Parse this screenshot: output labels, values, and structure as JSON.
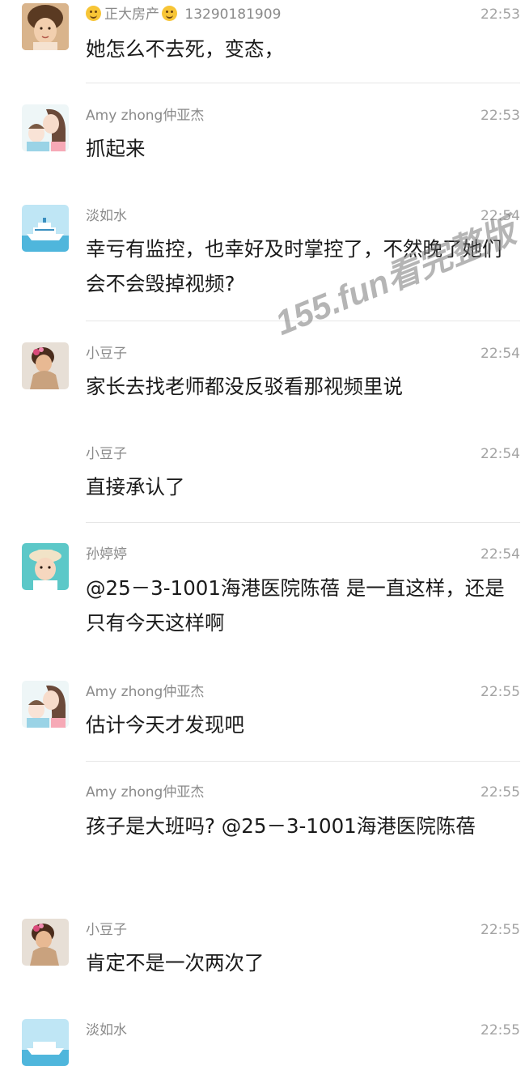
{
  "messages": [
    {
      "name_prefix_emoji": "smile-emoji",
      "name": "正大房产",
      "name_suffix_emoji": "smile-emoji",
      "name_rest": " 13290181909",
      "time": "22:53",
      "text": "她怎么不去死，变态，",
      "avatar": "girl-photo"
    },
    {
      "name": "Amy zhong仲亚杰",
      "time": "22:53",
      "text": "抓起来",
      "avatar": "mother-child-illustration"
    },
    {
      "name": "淡如水",
      "time": "22:54",
      "text": "幸亏有监控，也幸好及时掌控了，不然晚了她们会不会毁掉视频?",
      "avatar": "cruise-ship-illustration"
    },
    {
      "name": "小豆子",
      "time": "22:54",
      "text": "家长去找老师都没反驳看那视频里说",
      "avatar": "girl-flower-photo"
    },
    {
      "name": "小豆子",
      "time": "22:54",
      "text": "直接承认了",
      "avatar": ""
    },
    {
      "name": "孙婷婷",
      "time": "22:54",
      "text": "@25－3-1001海港医院陈蓓 是一直这样，还是只有今天这样啊",
      "avatar": "child-hat-photo"
    },
    {
      "name": "Amy zhong仲亚杰",
      "time": "22:55",
      "text": "估计今天才发现吧",
      "avatar": "mother-child-illustration"
    },
    {
      "name": "Amy zhong仲亚杰",
      "time": "22:55",
      "text": "孩子是大班吗? @25－3-1001海港医院陈蓓",
      "avatar": ""
    },
    {
      "name": "小豆子",
      "time": "22:55",
      "text": "肯定不是一次两次了",
      "avatar": "girl-flower-photo"
    },
    {
      "name": "淡如水",
      "time": "22:55",
      "text": "",
      "avatar": "cruise-ship-illustration"
    }
  ],
  "watermark": "155.fun看完整版"
}
